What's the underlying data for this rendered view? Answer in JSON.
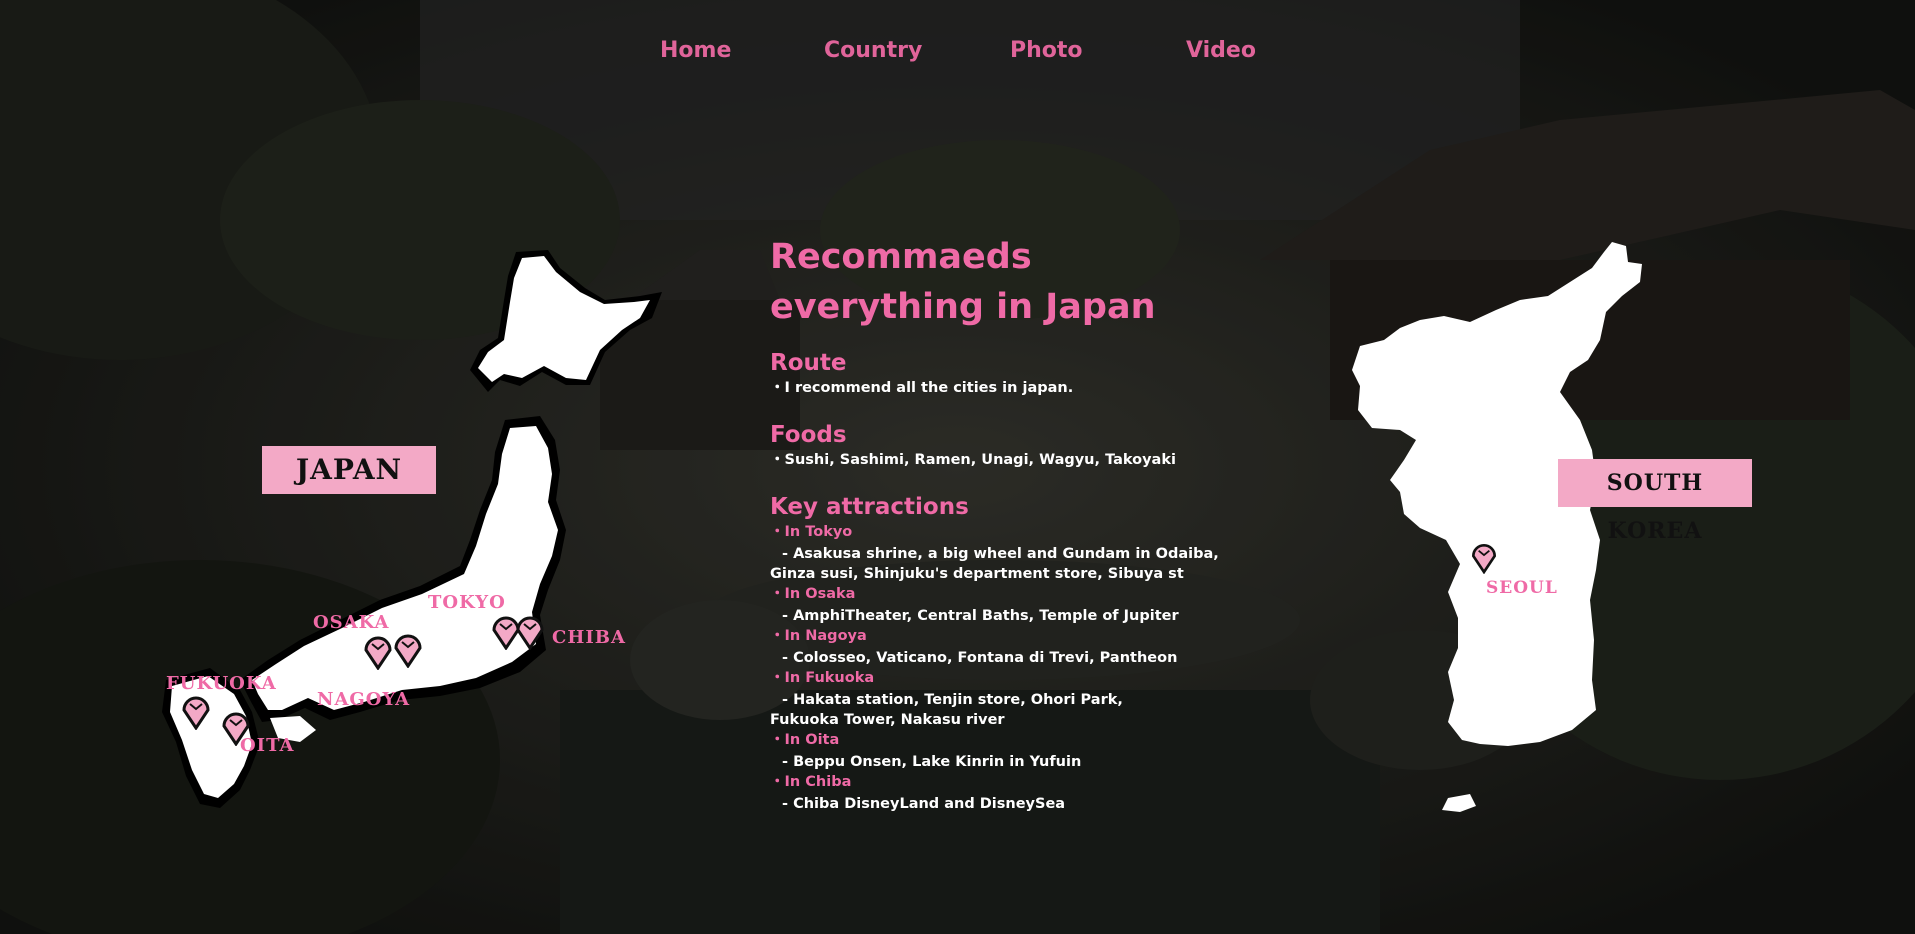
{
  "nav": {
    "home": "Home",
    "country": "Country",
    "photo": "Photo",
    "video": "Video"
  },
  "main": {
    "title_line1": "Recommaeds",
    "title_line2": "everything in Japan",
    "route": {
      "heading": "Route",
      "text": "・I recommend all the cities in japan."
    },
    "foods": {
      "heading": "Foods",
      "text": "・Sushi, Sashimi, Ramen, Unagi, Wagyu, Takoyaki"
    },
    "attractions": {
      "heading": "Key attractions",
      "items": [
        {
          "city": "・In Tokyo",
          "line1": "- Asakusa shrine, a big wheel and Gundam in Odaiba,",
          "line2": "Ginza susi, Shinjuku's department store, Sibuya st"
        },
        {
          "city": "・In Osaka",
          "line1": "- AmphiTheater, Central Baths, Temple of Jupiter"
        },
        {
          "city": "・In Nagoya",
          "line1": "- Colosseo, Vaticano, Fontana di Trevi, Pantheon"
        },
        {
          "city": "・In Fukuoka",
          "line1": "- Hakata station, Tenjin store, Ohori Park,",
          "line2": "Fukuoka Tower, Nakasu river"
        },
        {
          "city": "・In Oita",
          "line1": "- Beppu Onsen, Lake Kinrin in Yufuin"
        },
        {
          "city": "・In Chiba",
          "line1": "- Chiba DisneyLand and DisneySea"
        }
      ]
    }
  },
  "maps": {
    "japan_label": "JAPAN",
    "korea_label": "SOUTH KOREA",
    "japan_cities": {
      "osaka": "OSAKA",
      "tokyo": "TOKYO",
      "chiba": "CHIBA",
      "fukuoka": "FUKUOKA",
      "nagoya": "NAGOYA",
      "oita": "OITA"
    },
    "korea_cities": {
      "seoul": "SEOUL"
    },
    "pin_icon": "map-pin-icon",
    "pin_color": "#f3a9c6",
    "label_color": "#ef6aa6"
  },
  "colors": {
    "accent": "#ef6aa6",
    "nav": "#e0649a",
    "map_fill": "#ffffff",
    "label_bg": "#f3a9c6"
  }
}
